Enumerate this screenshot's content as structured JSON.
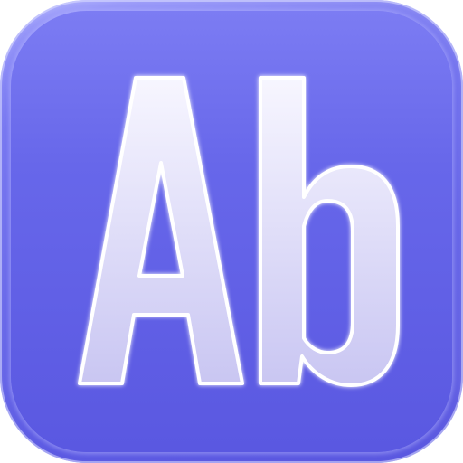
{
  "icon": {
    "semantic": "font-book-app-icon",
    "glyph_text": "Ab",
    "colors": {
      "background_top": "#8a8af8",
      "background_bottom": "#5754df",
      "glyph_fill_top": "#f7f6ff",
      "glyph_fill_bottom": "#c9c6f2",
      "glyph_outline": "#ffffff"
    }
  }
}
